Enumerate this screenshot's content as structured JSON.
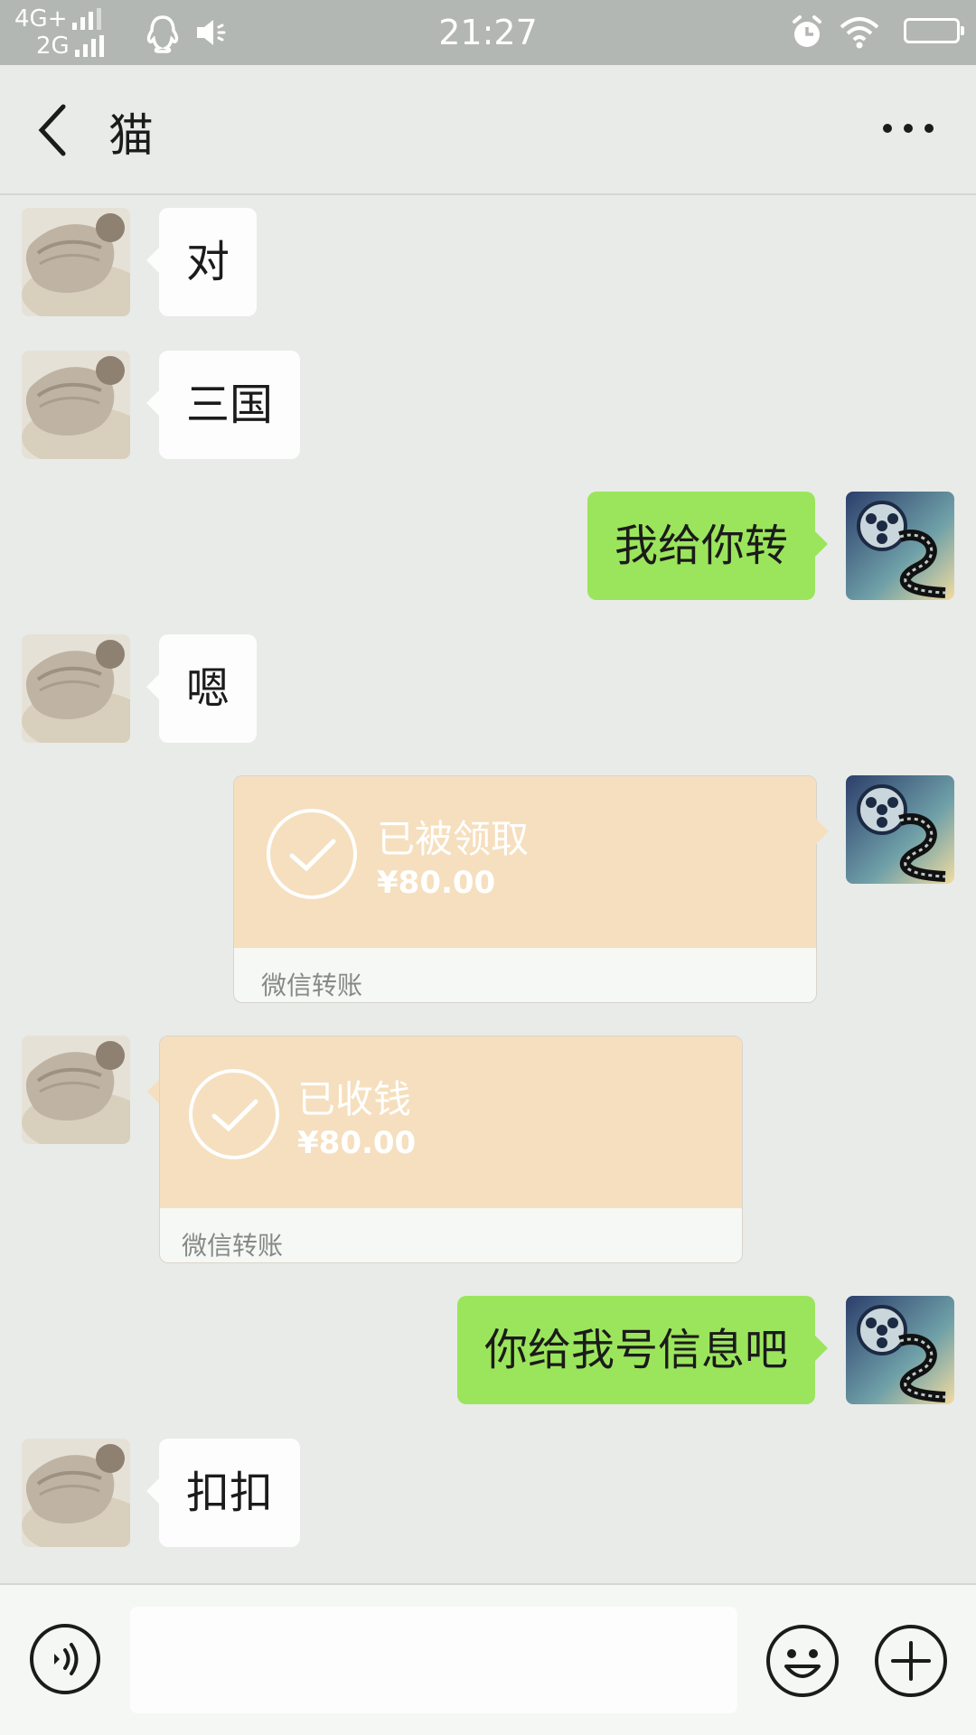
{
  "status_bar": {
    "network_1": "4G+",
    "network_2": "2G",
    "time": "21:27"
  },
  "nav": {
    "title": "猫"
  },
  "messages": [
    {
      "side": "incoming",
      "type": "text",
      "text": "对"
    },
    {
      "side": "incoming",
      "type": "text",
      "text": "三国"
    },
    {
      "side": "outgoing",
      "type": "text",
      "text": "我给你转"
    },
    {
      "side": "incoming",
      "type": "text",
      "text": "嗯"
    },
    {
      "side": "outgoing",
      "type": "transfer",
      "status": "已被领取",
      "amount": "¥80.00",
      "footer": "微信转账"
    },
    {
      "side": "incoming",
      "type": "transfer",
      "status": "已收钱",
      "amount": "¥80.00",
      "footer": "微信转账"
    },
    {
      "side": "outgoing",
      "type": "text",
      "text": "你给我号信息吧"
    },
    {
      "side": "incoming",
      "type": "text",
      "text": "扣扣"
    }
  ],
  "input": {
    "value": "",
    "placeholder": ""
  },
  "icons": {
    "back": "chevron-left-icon",
    "more": "more-dots-icon",
    "voice": "voice-icon",
    "emoji": "emoji-icon",
    "plus": "plus-icon"
  },
  "colors": {
    "background": "#e8ebe8",
    "outgoing_bubble": "#9be55c",
    "incoming_bubble": "#fcfdfc",
    "transfer_card": "#f5dfbe"
  }
}
